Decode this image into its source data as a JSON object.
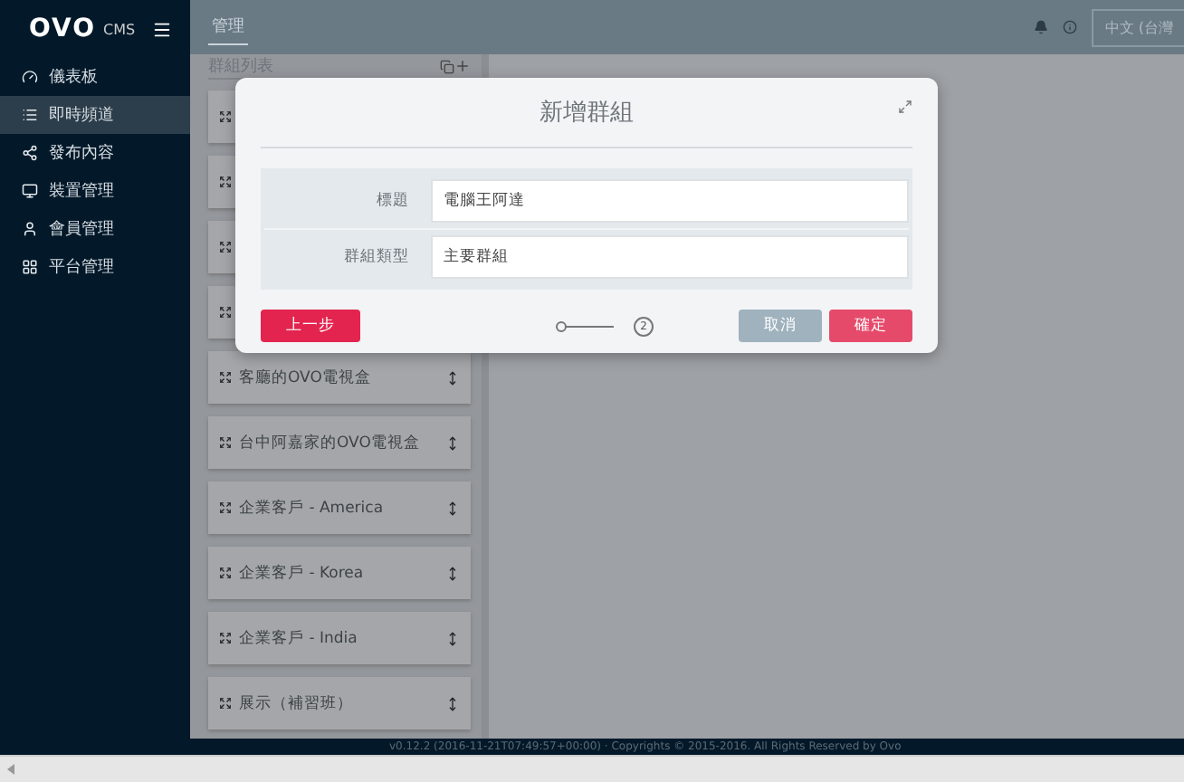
{
  "brand": {
    "logo": "OVO",
    "suffix": "CMS"
  },
  "sidebar": {
    "items": [
      {
        "label": "儀表板",
        "selected": false
      },
      {
        "label": "即時頻道",
        "selected": true
      },
      {
        "label": "發布內容",
        "selected": false
      },
      {
        "label": "裝置管理",
        "selected": false
      },
      {
        "label": "會員管理",
        "selected": false
      },
      {
        "label": "平台管理",
        "selected": false
      }
    ]
  },
  "topbar": {
    "tabs": [
      {
        "label": "管理",
        "selected": true
      }
    ],
    "language": "中文 (台灣"
  },
  "group_panel": {
    "title": "群組列表",
    "items": [
      {
        "kind": "covered"
      },
      {
        "kind": "covered"
      },
      {
        "kind": "covered"
      },
      {
        "kind": "covered"
      },
      {
        "kind": "group",
        "label": "客廳的OVO電視盒"
      },
      {
        "kind": "group",
        "label": "台中阿嘉家的OVO電視盒"
      },
      {
        "kind": "group",
        "label": "企業客戶 - America"
      },
      {
        "kind": "group",
        "label": "企業客戶 - Korea"
      },
      {
        "kind": "group",
        "label": "企業客戶 - India"
      },
      {
        "kind": "group",
        "label": "展示（補習班）"
      }
    ]
  },
  "dialog": {
    "title": "新增群組",
    "fields": [
      {
        "label": "標題",
        "value": "電腦王阿達"
      },
      {
        "label": "群組類型",
        "value": "主要群組"
      }
    ],
    "back": "上一步",
    "step": "2",
    "cancel": "取消",
    "confirm": "確定"
  },
  "footer": "v0.12.2 (2016-11-21T07:49:57+00:00) · Copyrights © 2015-2016. All Rights Reserved by Ovo"
}
